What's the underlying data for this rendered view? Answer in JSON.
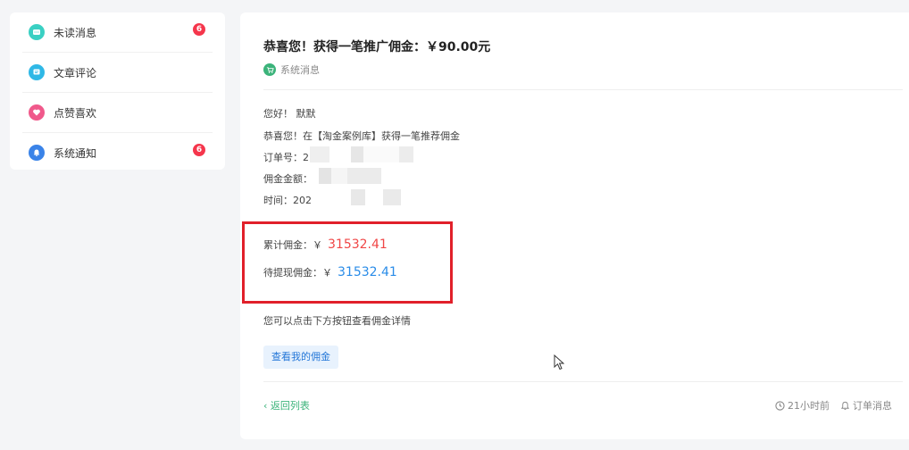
{
  "sidebar": {
    "items": [
      {
        "label": "未读消息",
        "icon": "message-icon",
        "color": "#3ad0c3",
        "badge": "6"
      },
      {
        "label": "文章评论",
        "icon": "comment-icon",
        "color": "#2fb8e6",
        "badge": ""
      },
      {
        "label": "点赞喜欢",
        "icon": "heart-icon",
        "color": "#f0598b",
        "badge": ""
      },
      {
        "label": "系统通知",
        "icon": "bell-icon",
        "color": "#3a83e8",
        "badge": "6"
      }
    ]
  },
  "message": {
    "title": "恭喜您！获得一笔推广佣金：￥90.00元",
    "sender": "系统消息",
    "greeting": "您好！ 默默",
    "congrats": "恭喜您！在【淘金案例库】获得一笔推荐佣金",
    "order_label": "订单号：2",
    "amount_label": "佣金金额：",
    "time_label": "时间：202",
    "total_label": "累计佣金：￥",
    "total_value": "31532.41",
    "pending_label": "待提现佣金：￥",
    "pending_value": "31532.41",
    "hint": "您可以点击下方按钮查看佣金详情",
    "button_label": "查看我的佣金"
  },
  "footer": {
    "back_label": "返回列表",
    "time_ago": "21小时前",
    "category": "订单消息"
  },
  "colors": {
    "accent_green": "#3bb37a",
    "highlight_red": "#e1202a",
    "amount_red": "#f04646",
    "amount_blue": "#2a8ce8",
    "badge_red": "#f5364c"
  }
}
